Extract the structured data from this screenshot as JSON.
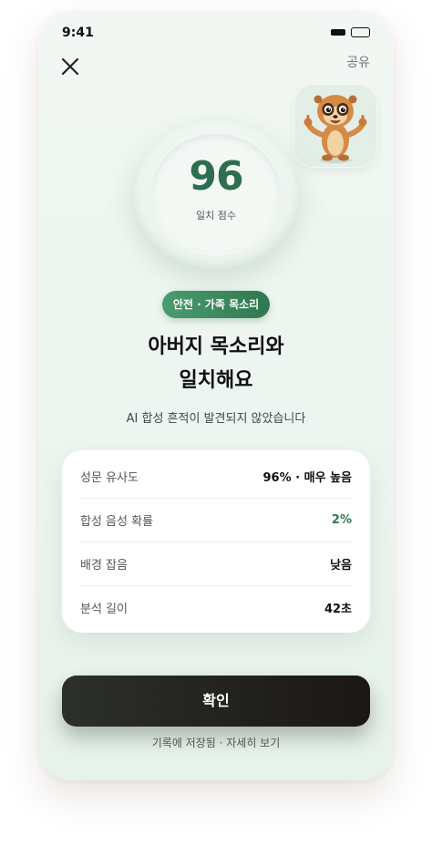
{
  "status_bar": {
    "time": "9:41"
  },
  "header": {
    "share_label": "공유"
  },
  "score": {
    "value": "96",
    "label": "일치 점수"
  },
  "badge": {
    "label": "안전 · 가족 목소리"
  },
  "result": {
    "headline_line1": "아버지 목소리와",
    "headline_line2": "일치해요",
    "subtitle": "AI 합성 흔적이 발견되지 않았습니다"
  },
  "details": {
    "rows": [
      {
        "label": "성문 유사도",
        "value": "96% · 매우 높음"
      },
      {
        "label": "합성 음성 확률",
        "value": "2%"
      },
      {
        "label": "배경 잡음",
        "value": "낮음"
      },
      {
        "label": "분석 길이",
        "value": "42초"
      }
    ]
  },
  "actions": {
    "confirm_label": "확인",
    "footer_link": "기록에 저장됨 · 자세히 보기"
  },
  "colors": {
    "accent_green": "#2f7751",
    "score_green": "#2d6e4e",
    "button_dark": "#1a1715"
  },
  "icons": {
    "close": "close-icon",
    "mascot": "meerkat-mascot",
    "signal": "signal-icon",
    "battery": "battery-icon"
  }
}
